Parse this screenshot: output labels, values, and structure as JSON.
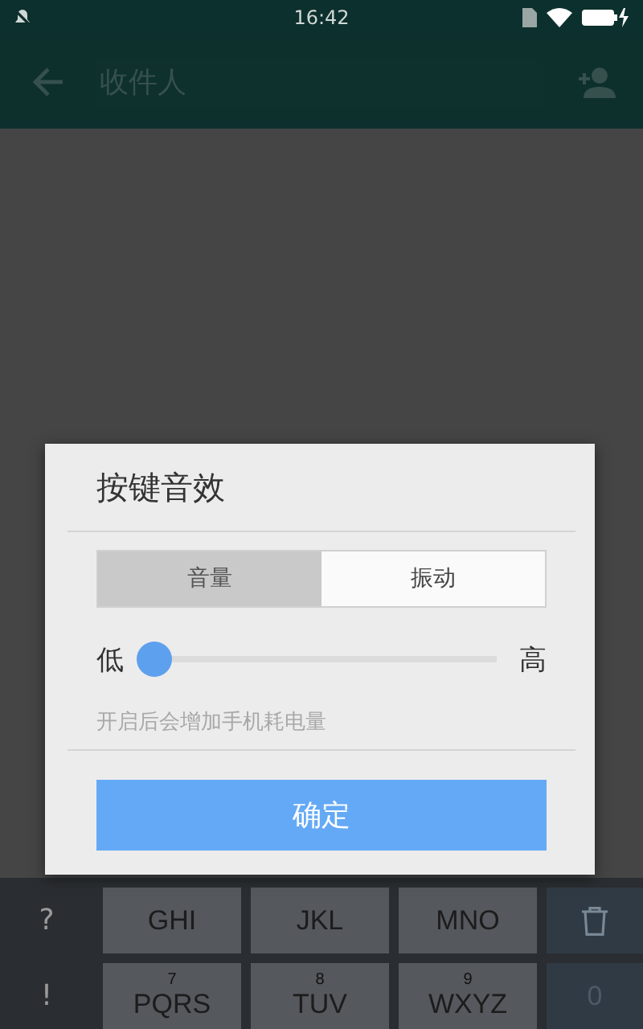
{
  "status_bar": {
    "time": "16:42"
  },
  "app_bar": {
    "placeholder": "收件人"
  },
  "keyboard": {
    "rows": [
      {
        "side": "?",
        "keys": [
          {
            "label": "GHI"
          },
          {
            "label": "JKL"
          },
          {
            "label": "MNO"
          }
        ],
        "end": {
          "kind": "delete"
        }
      },
      {
        "side": "!",
        "keys": [
          {
            "digit": "7",
            "label": "PQRS"
          },
          {
            "digit": "8",
            "label": "TUV"
          },
          {
            "digit": "9",
            "label": "WXYZ"
          }
        ],
        "end": {
          "kind": "text",
          "label": "0"
        }
      }
    ]
  },
  "dialog": {
    "title": "按键音效",
    "tabs": [
      {
        "label": "音量",
        "selected": true
      },
      {
        "label": "振动",
        "selected": false
      }
    ],
    "slider": {
      "min_label": "低",
      "max_label": "高",
      "level": 0.0
    },
    "hint": "开启后会增加手机耗电量",
    "button": "确定"
  }
}
